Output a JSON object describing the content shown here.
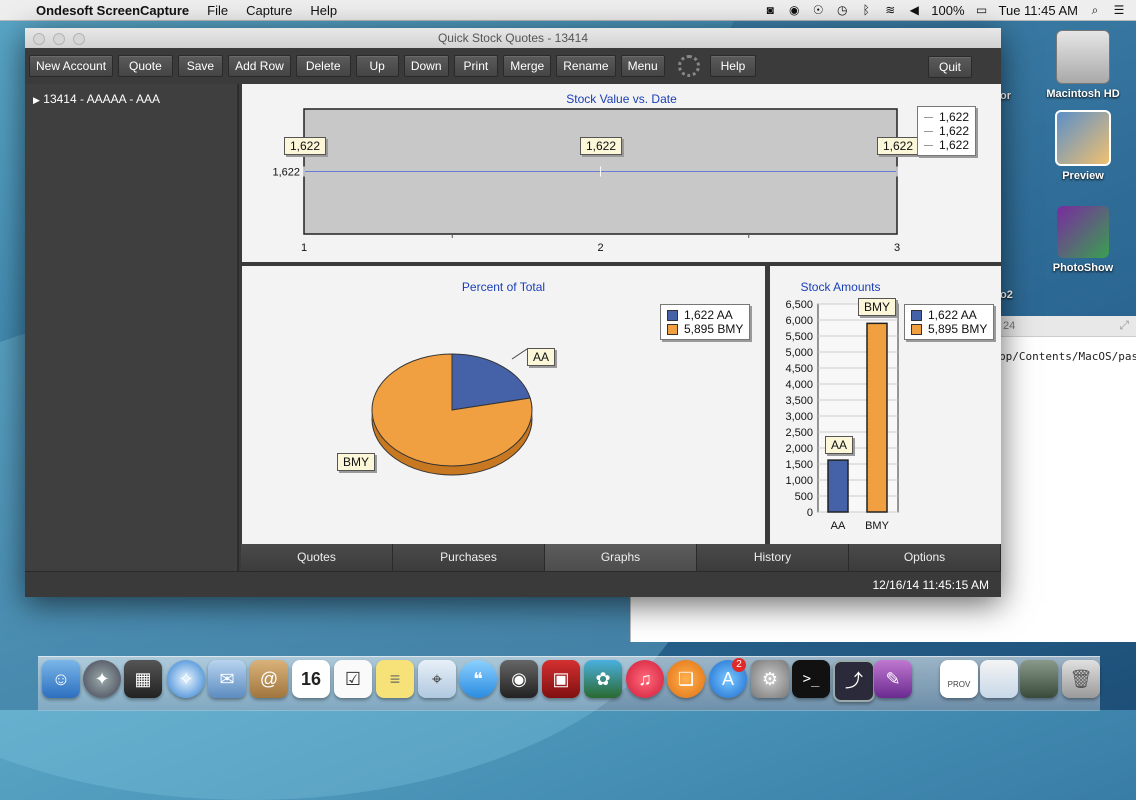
{
  "menubar": {
    "app_name": "Ondesoft ScreenCapture",
    "menus": [
      "File",
      "Capture",
      "Help"
    ],
    "battery": "100%",
    "clock": "Tue 11:45 AM"
  },
  "desktop": {
    "icons": [
      "Macintosh HD",
      "Preview",
      "PhotoShow"
    ],
    "partial_labels": [
      "or",
      "o2"
    ],
    "bg_window": {
      "title_fragment": "24",
      "text": "pp/Contents/MacOS/pas"
    }
  },
  "window": {
    "title": "Quick Stock Quotes - 13414",
    "toolbar": {
      "buttons": [
        "New Account",
        "Quote",
        "Save",
        "Add Row",
        "Delete",
        "Up",
        "Down",
        "Print",
        "Merge",
        "Rename",
        "Menu"
      ],
      "help": "Help",
      "quit": "Quit"
    },
    "sidebar": {
      "item": "13414 - AAAAA - AAA",
      "expander": "▶"
    },
    "tabs": [
      "Quotes",
      "Purchases",
      "Graphs",
      "History",
      "Options"
    ],
    "active_tab": "Graphs",
    "status_time": "12/16/14 11:45:15 AM"
  },
  "chart_data": [
    {
      "type": "line",
      "title": "Stock Value vs. Date",
      "x": [
        1,
        2,
        3
      ],
      "series": [
        {
          "values": [
            1622,
            1622,
            1622
          ]
        }
      ],
      "ytick_labels": [
        "1,622"
      ],
      "xtick_labels": [
        "1",
        "2",
        "3"
      ],
      "point_labels": [
        "1,622",
        "1,622",
        "1,622"
      ],
      "legend": [
        "1,622",
        "1,622",
        "1,622"
      ],
      "legend_position": "top-right"
    },
    {
      "type": "pie",
      "title": "Percent of Total",
      "labels": [
        "AA",
        "BMY"
      ],
      "values": [
        1622,
        5895
      ],
      "legend": [
        "1,622 AA",
        "5,895 BMY"
      ],
      "colors": [
        "#4562a8",
        "#f0a040"
      ],
      "legend_position": "top-right"
    },
    {
      "type": "bar",
      "title": "Stock Amounts",
      "categories": [
        "AA",
        "BMY"
      ],
      "values": [
        1622,
        5895
      ],
      "ylim": [
        0,
        6500
      ],
      "ytick_labels": [
        "6,500",
        "6,000",
        "5,500",
        "5,000",
        "4,500",
        "4,000",
        "3,500",
        "3,000",
        "2,500",
        "2,000",
        "1,500",
        "1,000",
        "500",
        "0"
      ],
      "bar_labels": [
        "AA",
        "BMY"
      ],
      "legend": [
        "1,622 AA",
        "5,895 BMY"
      ],
      "colors": [
        "#4562a8",
        "#f0a040"
      ],
      "legend_position": "top-right"
    }
  ],
  "dock": {
    "badge": "2",
    "calendar_day": "16",
    "prov_label": "PROV"
  }
}
